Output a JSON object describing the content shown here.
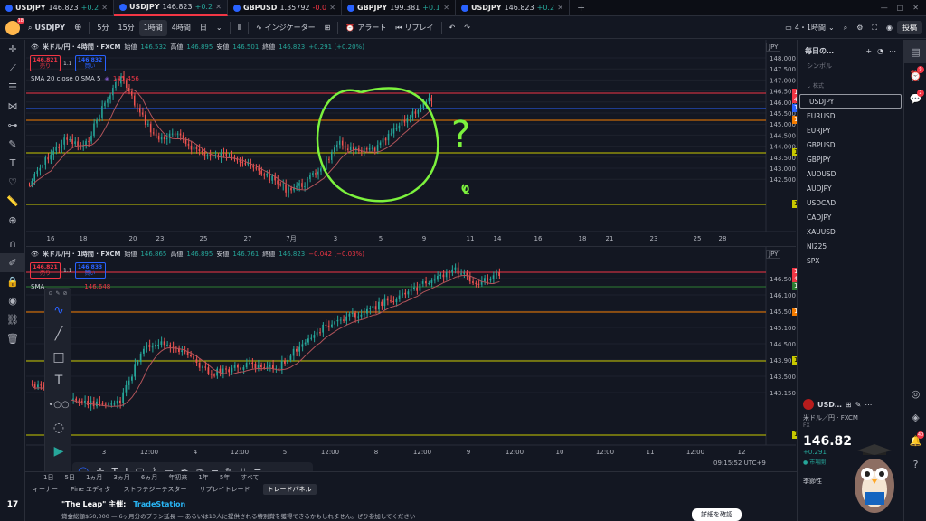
{
  "tabs": [
    {
      "sym": "USDJPY",
      "price": "146.823",
      "change": "+0.2",
      "dir": "up",
      "active": false,
      "notif": "18"
    },
    {
      "sym": "USDJPY",
      "price": "146.823",
      "change": "+0.2",
      "dir": "up",
      "active": true
    },
    {
      "sym": "GBPUSD",
      "price": "1.35792",
      "change": "-0.0",
      "dir": "dn",
      "active": false
    },
    {
      "sym": "GBPJPY",
      "price": "199.381",
      "change": "+0.1",
      "dir": "up",
      "active": false
    },
    {
      "sym": "USDJPY",
      "price": "146.823",
      "change": "+0.2",
      "dir": "up",
      "active": false
    }
  ],
  "toolbar": {
    "symbol": "USDJPY",
    "intervals": [
      "5分",
      "15分",
      "1時間",
      "4時間",
      "日"
    ],
    "selected_interval": "1時間",
    "indicators": "インジケーター",
    "alert": "アラート",
    "replay": "リプレイ",
    "layout": "4・1時間",
    "publish": "投稿"
  },
  "chart_top": {
    "title": "米ドル/円 · 4時間 · FXCM",
    "ohlc": {
      "o_label": "始値",
      "o": "146.532",
      "h_label": "高値",
      "h": "146.895",
      "l_label": "安値",
      "l": "146.501",
      "c_label": "終値",
      "c": "146.823",
      "chg": "+0.291 (+0.20%)"
    },
    "sell": {
      "price": "146.821",
      "label": "売り"
    },
    "spread": "1.1",
    "buy": {
      "price": "146.832",
      "label": "買い"
    },
    "sma": "SMA 20 close 0 SMA 5",
    "sma_val": "145.456",
    "currency": "JPY",
    "price_labels": [
      "148.000",
      "147.500",
      "147.000",
      "146.500",
      "146.000",
      "145.500",
      "145.000",
      "144.500",
      "144.000",
      "143.500",
      "143.000",
      "142.500"
    ],
    "tags": [
      {
        "v": "146.823",
        "sub": "46:07",
        "c": "#f23645"
      },
      {
        "v": "146.363",
        "c": "#2962ff"
      },
      {
        "v": "145.906",
        "c": "#f57c00"
      },
      {
        "v": "144.767",
        "c": "#c8c800",
        "dark": true
      },
      {
        "v": "143.003",
        "c": "#c8c800",
        "dark": true
      }
    ],
    "time_labels": [
      "16",
      "18",
      "20",
      "23",
      "25",
      "27",
      "7月",
      "3",
      "5",
      "9",
      "11",
      "14",
      "16",
      "18",
      "21",
      "23",
      "25",
      "28"
    ]
  },
  "chart_bottom": {
    "title": "米ドル/円 · 1時間 · FXCM",
    "ohlc": {
      "o_label": "始値",
      "o": "146.865",
      "h_label": "高値",
      "h": "146.895",
      "l_label": "安値",
      "l": "146.761",
      "c_label": "終値",
      "c": "146.823",
      "chg": "−0.042 (−0.03%)"
    },
    "sell": {
      "price": "146.821",
      "label": "売り"
    },
    "spread": "1.1",
    "buy": {
      "price": "146.833",
      "label": "買い"
    },
    "sma": "SMA",
    "sma_val": "146.648",
    "currency": "JPY",
    "price_labels": [
      "146.500",
      "146.100",
      "145.500",
      "145.100",
      "144.500",
      "143.900",
      "143.500",
      "143.150"
    ],
    "tags": [
      {
        "v": "146.823",
        "sub": "43:06",
        "c": "#f23645"
      },
      {
        "v": "146.463",
        "c": "#2e7d32"
      },
      {
        "v": "145.906",
        "c": "#f57c00"
      },
      {
        "v": "144.767",
        "c": "#c8c800",
        "dark": true
      },
      {
        "v": "143.003",
        "c": "#c8c800",
        "dark": true
      }
    ],
    "time_labels": [
      "3",
      "12:00",
      "4",
      "12:00",
      "5",
      "12:00",
      "8",
      "12:00",
      "9",
      "12:00",
      "10",
      "12:00",
      "11",
      "12:00",
      "12"
    ],
    "clock": "09:15:52 UTC+9"
  },
  "watchlist": {
    "title": "毎日の…",
    "symbol_header": "シンボル",
    "group": "株式",
    "items": [
      "USDJPY",
      "EURUSD",
      "EURJPY",
      "GBPUSD",
      "GBPJPY",
      "AUDUSD",
      "AUDJPY",
      "USDCAD",
      "CADJPY",
      "XAUUSD",
      "NI225",
      "SPX"
    ],
    "selected": "USDJPY"
  },
  "detail": {
    "sym": "USD…",
    "name": "米ドル／円",
    "source": "FXCM",
    "type": "FX",
    "price": "146.82",
    "change": "+0.291",
    "status": "市場開",
    "seasonality": "季節性"
  },
  "bottom": {
    "tabs": [
      "ィーナー",
      "Pine エディタ",
      "ストラテジーテスター",
      "リプレイトレード"
    ],
    "panel": "トレードパネル",
    "ranges": [
      "1日",
      "5日",
      "1ヵ月",
      "3ヵ月",
      "6ヵ月",
      "年初来",
      "1年",
      "5年",
      "すべて"
    ],
    "promo_title": "\"The Leap\" 主催:",
    "promo_brand": "TradeStation",
    "promo_text": "賞金総額$50,000 — 6ヶ月分のプラン延長 — あるいは10人に提供される特別賞を獲得できるかもしれません。ぜひ参加してください",
    "promo_btn": "詳細を確認"
  },
  "annotations": {
    "q": "?"
  },
  "colors": {
    "up": "#26a69a",
    "down": "#ef5350",
    "sma20": "#b2545a",
    "circle": "#7cf23d"
  }
}
